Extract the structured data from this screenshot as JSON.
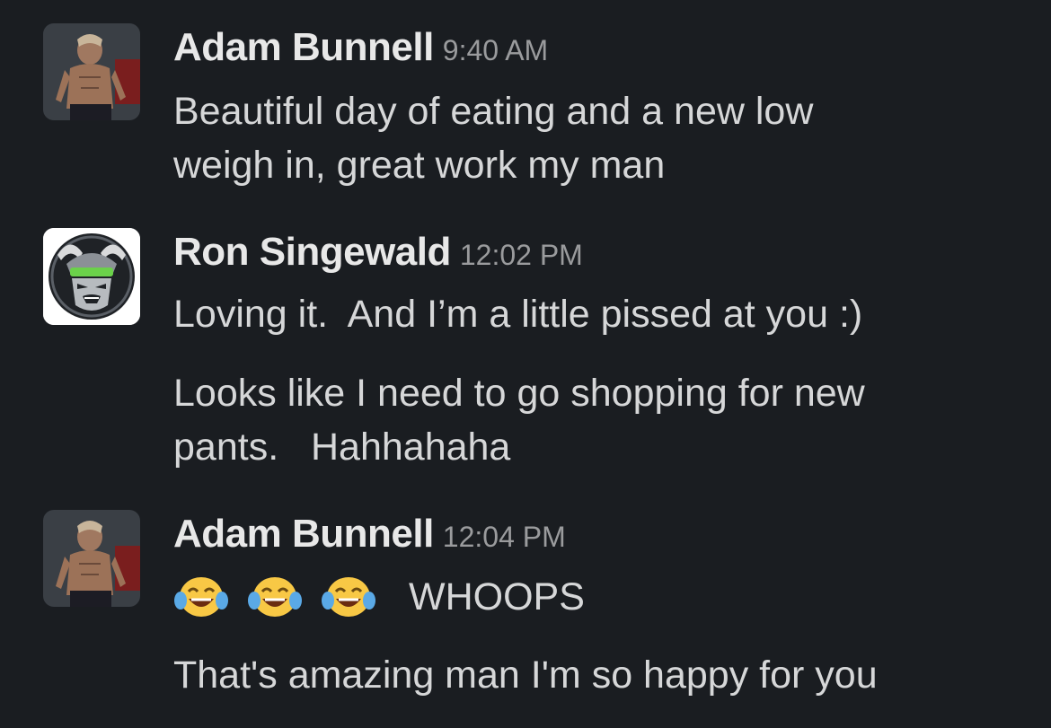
{
  "messages": [
    {
      "sender": "Adam Bunnell",
      "time": "9:40 AM",
      "avatar": "person-photo-avatar",
      "lines": [
        "Beautiful day of eating and a new low\nweigh in, great work my man"
      ]
    },
    {
      "sender": "Ron  Singewald",
      "time": "12:02 PM",
      "avatar": "samurai-mask-logo-avatar",
      "lines": [
        "Loving it.  And I’m a little pissed at you :)",
        "Looks like I need to go shopping for new\npants.   Hahhahaha"
      ]
    },
    {
      "sender": "Adam Bunnell",
      "time": "12:04 PM",
      "avatar": "person-photo-avatar",
      "emojis": [
        "joy-emoji",
        "joy-emoji",
        "joy-emoji"
      ],
      "emoji_text": "WHOOPS",
      "lines": [
        "That's amazing man I'm so happy for you"
      ]
    }
  ],
  "colors": {
    "background": "#1a1d21",
    "sender": "#e8e8e8",
    "timestamp": "#9a9b9d",
    "text": "#d6d7d8",
    "logo_green": "#6bd14a"
  }
}
